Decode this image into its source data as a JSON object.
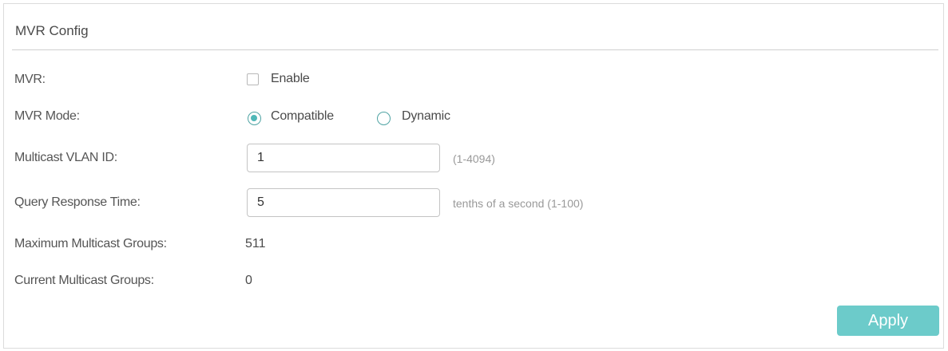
{
  "panel": {
    "title": "MVR Config"
  },
  "fields": {
    "mvr": {
      "label": "MVR:",
      "checkbox_label": "Enable",
      "checked": false
    },
    "mvr_mode": {
      "label": "MVR Mode:",
      "options": [
        "Compatible",
        "Dynamic"
      ],
      "selected": "Compatible"
    },
    "multicast_vlan_id": {
      "label": "Multicast VLAN ID:",
      "value": "1",
      "hint": "(1-4094)"
    },
    "query_response_time": {
      "label": "Query Response Time:",
      "value": "5",
      "hint": "tenths of a second (1-100)"
    },
    "maximum_multicast_groups": {
      "label": "Maximum Multicast Groups:",
      "value": "511"
    },
    "current_multicast_groups": {
      "label": "Current Multicast Groups:",
      "value": "0"
    }
  },
  "actions": {
    "apply_label": "Apply"
  },
  "colors": {
    "accent": "#6ccbca",
    "radio_border": "#4fa3a3"
  }
}
